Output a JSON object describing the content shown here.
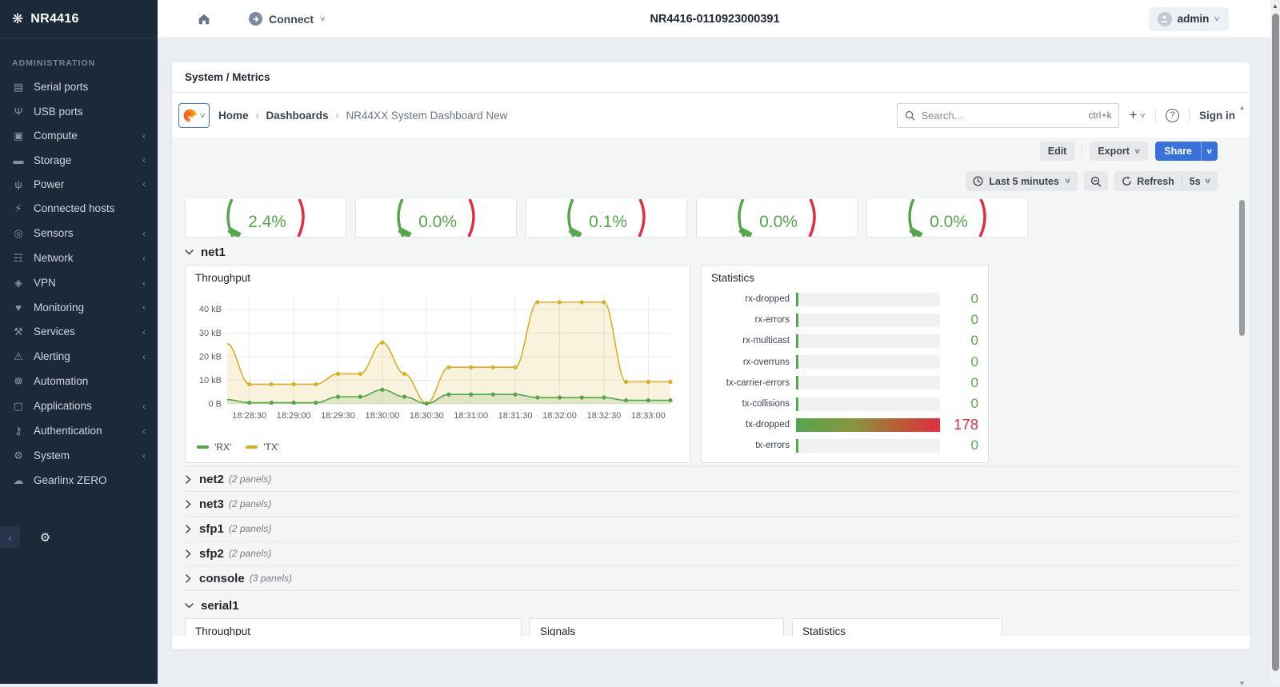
{
  "app": {
    "product": "NR4416",
    "window_title": "NR4416-0110923000391",
    "connect_label": "Connect",
    "user_label": "admin"
  },
  "sidebar": {
    "section_label": "ADMINISTRATION",
    "items": [
      {
        "label": "Serial ports",
        "icon": "serial-ports-icon",
        "glyph": "▤",
        "submenu": false
      },
      {
        "label": "USB ports",
        "icon": "usb-ports-icon",
        "glyph": "Ψ",
        "submenu": false
      },
      {
        "label": "Compute",
        "icon": "compute-icon",
        "glyph": "▣",
        "submenu": true
      },
      {
        "label": "Storage",
        "icon": "storage-icon",
        "glyph": "▬",
        "submenu": true
      },
      {
        "label": "Power",
        "icon": "power-plug-icon",
        "glyph": "ψ",
        "submenu": true
      },
      {
        "label": "Connected hosts",
        "icon": "lightning-icon",
        "glyph": "⚡",
        "submenu": false
      },
      {
        "label": "Sensors",
        "icon": "sensor-icon",
        "glyph": "◎",
        "submenu": true
      },
      {
        "label": "Network",
        "icon": "network-icon",
        "glyph": "☷",
        "submenu": true
      },
      {
        "label": "VPN",
        "icon": "shield-icon",
        "glyph": "◈",
        "submenu": true
      },
      {
        "label": "Monitoring",
        "icon": "heart-pulse-icon",
        "glyph": "♥",
        "submenu": true
      },
      {
        "label": "Services",
        "icon": "tools-icon",
        "glyph": "⚒",
        "submenu": true
      },
      {
        "label": "Alerting",
        "icon": "warning-icon",
        "glyph": "⚠",
        "submenu": true
      },
      {
        "label": "Automation",
        "icon": "robot-icon",
        "glyph": "☸",
        "submenu": false
      },
      {
        "label": "Applications",
        "icon": "monitor-icon",
        "glyph": "▢",
        "submenu": true
      },
      {
        "label": "Authentication",
        "icon": "key-icon",
        "glyph": "⚷",
        "submenu": true
      },
      {
        "label": "System",
        "icon": "gear-icon",
        "glyph": "⚙",
        "submenu": true
      },
      {
        "label": "Gearlinx ZERO",
        "icon": "cloud-icon",
        "glyph": "☁",
        "submenu": false
      }
    ]
  },
  "page": {
    "title": "System / Metrics"
  },
  "grafana": {
    "breadcrumb": [
      "Home",
      "Dashboards",
      "NR44XX System Dashboard New"
    ],
    "breadcrumb_separator": "›",
    "search": {
      "placeholder": "Search...",
      "shortcut": "ctrl+k"
    },
    "signin_label": "Sign in",
    "actions": {
      "edit": "Edit",
      "export": "Export",
      "share": "Share"
    },
    "timebar": {
      "range": "Last 5 minutes",
      "refresh": "Refresh",
      "interval": "5s"
    },
    "gauges": [
      {
        "value": "2.4%"
      },
      {
        "value": "0.0%"
      },
      {
        "value": "0.1%"
      },
      {
        "value": "0.0%"
      },
      {
        "value": "0.0%"
      }
    ],
    "net1": {
      "name": "net1",
      "throughput_title": "Throughput"
    },
    "collapsed_sections": [
      {
        "name": "net2",
        "count": "(2 panels)"
      },
      {
        "name": "net3",
        "count": "(2 panels)"
      },
      {
        "name": "sfp1",
        "count": "(2 panels)"
      },
      {
        "name": "sfp2",
        "count": "(2 panels)"
      },
      {
        "name": "console",
        "count": "(3 panels)"
      }
    ],
    "serial1": {
      "name": "serial1",
      "panels": [
        "Throughput",
        "Signals",
        "Statistics"
      ]
    }
  },
  "stats_panel": {
    "title": "Statistics",
    "rows": [
      {
        "label": "rx-dropped",
        "value": "0",
        "state": "ok"
      },
      {
        "label": "rx-errors",
        "value": "0",
        "state": "ok"
      },
      {
        "label": "rx-multicast",
        "value": "0",
        "state": "ok"
      },
      {
        "label": "rx-overruns",
        "value": "0",
        "state": "ok"
      },
      {
        "label": "tx-carrier-errors",
        "value": "0",
        "state": "ok"
      },
      {
        "label": "tx-collisions",
        "value": "0",
        "state": "ok"
      },
      {
        "label": "tx-dropped",
        "value": "178",
        "state": "alert"
      },
      {
        "label": "tx-errors",
        "value": "0",
        "state": "ok"
      }
    ]
  },
  "chart_data": {
    "type": "area",
    "title": "Throughput",
    "x_ticks": [
      "18:28:30",
      "18:29:00",
      "18:29:30",
      "18:30:00",
      "18:30:30",
      "18:31:00",
      "18:31:30",
      "18:32:00",
      "18:32:30",
      "18:33:00"
    ],
    "y_ticks": [
      {
        "value": 0,
        "label": "0 B"
      },
      {
        "value": 10,
        "label": "10 kB"
      },
      {
        "value": 20,
        "label": "20 kB"
      },
      {
        "value": 30,
        "label": "30 kB"
      },
      {
        "value": 40,
        "label": "40 kB"
      }
    ],
    "y_max_kb": 46,
    "grid": true,
    "legend_position": "bottom",
    "series": [
      {
        "name": "'TX'",
        "color": "#d9af27",
        "fill": "rgba(217,175,39,0.16)",
        "values_kb": [
          25.5,
          8.3,
          8.3,
          8.3,
          8.3,
          12.7,
          12.7,
          26,
          12.7,
          0.2,
          15.5,
          15.5,
          15.5,
          15.5,
          43,
          43,
          43,
          43,
          9.3,
          9.3,
          9.3
        ]
      },
      {
        "name": "'RX'",
        "color": "#56a64b",
        "fill": "rgba(86,166,75,0.16)",
        "values_kb": [
          1.8,
          0.5,
          0.5,
          0.5,
          0.5,
          3,
          3,
          6,
          3,
          0.1,
          4,
          4,
          4,
          4,
          2.7,
          2.7,
          2.7,
          2.7,
          1.5,
          1.5,
          1.5
        ]
      }
    ],
    "legend": [
      {
        "label": "'RX'",
        "color": "#56a64b"
      },
      {
        "label": "'TX'",
        "color": "#d9af27"
      }
    ]
  },
  "colors": {
    "accent_blue": "#3871dc",
    "ok_green": "#56a64b",
    "alert_red": "#e02f44",
    "tx_yellow": "#d9af27",
    "sidebar_bg": "#1c2938",
    "dashboard_bg": "#f4f5f5"
  }
}
